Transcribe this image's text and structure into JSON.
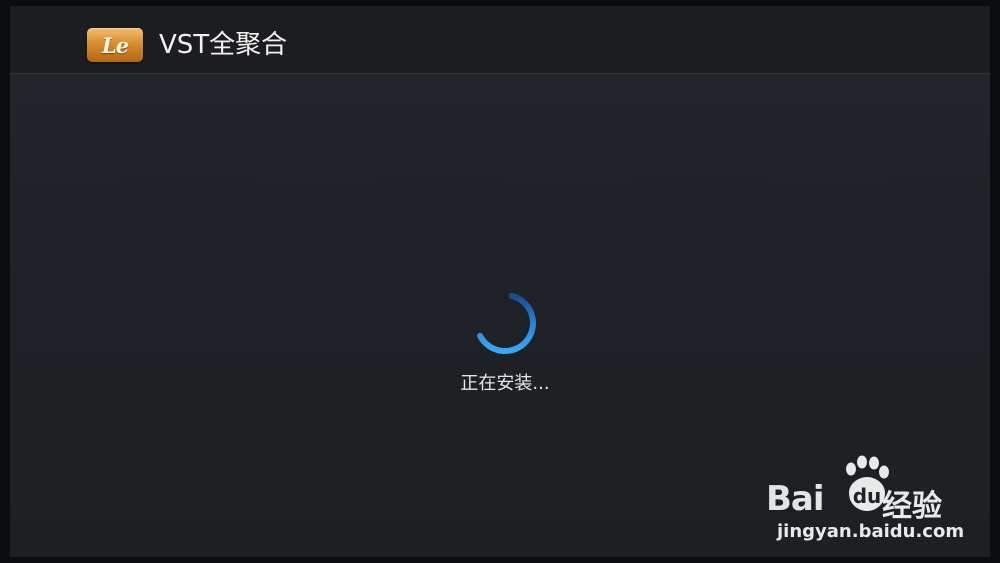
{
  "header": {
    "logo_text": "Le",
    "title": "VST全聚合"
  },
  "main": {
    "status_text": "正在安装..."
  },
  "watermark": {
    "brand_text": "Bai",
    "brand_cn": "经验",
    "url": "jingyan.baidu.com"
  },
  "colors": {
    "background": "#1f2226",
    "header_bg": "#1c1d20",
    "spinner_accent": "#2f8ee6",
    "logo_gold": "#d98e2f"
  },
  "icons": {
    "app_logo": "letv-logo-icon",
    "spinner": "loading-spinner-icon",
    "watermark_paw": "baidu-paw-icon"
  }
}
